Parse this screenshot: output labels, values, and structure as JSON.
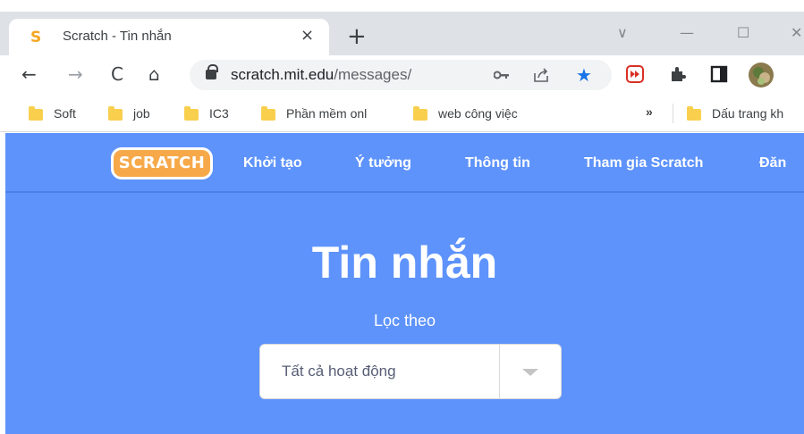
{
  "browser": {
    "tab": {
      "title": "Scratch - Tin nhắn",
      "favicon": "S",
      "close": "×"
    },
    "new_tab": "+",
    "window_controls": {
      "minimize": "—",
      "maximize": "☐",
      "close": "✕",
      "chevron": "∨"
    },
    "nav": {
      "back": "←",
      "forward": "→",
      "reload": "C",
      "home": "⌂"
    },
    "address": {
      "domain": "scratch.mit.edu",
      "path": "/messages/"
    },
    "icons": {
      "key": "key-icon",
      "share": "share-icon",
      "star": "★"
    },
    "extensions": [
      "media-extension-icon",
      "puzzle-icon",
      "side-panel-icon",
      "profile-avatar"
    ]
  },
  "bookmarks": {
    "items": [
      "Soft",
      "job",
      "IC3",
      "Phần mềm onl",
      "web công việc"
    ],
    "overflow": "»",
    "other": "Dấu trang kh"
  },
  "site": {
    "logo": "SCRATCH",
    "nav": [
      "Khởi tạo",
      "Ý tưởng",
      "Thông tin",
      "Tham gia Scratch",
      "Đăn"
    ],
    "title": "Tin nhắn",
    "filter_label": "Lọc theo",
    "filter_value": "Tất cả hoạt động",
    "brand_color": "#5e93fb"
  }
}
